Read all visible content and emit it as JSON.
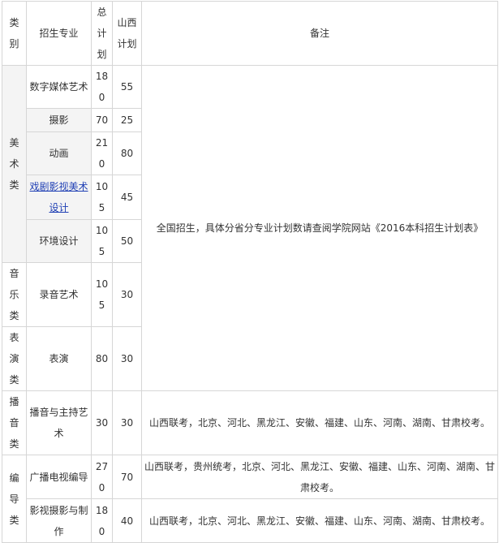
{
  "headers": {
    "category": "类别",
    "major": "招生专业",
    "total": "总计划",
    "shanxi": "山西计划",
    "note": "备注"
  },
  "categories": {
    "arts": "美术类",
    "music": "音乐类",
    "performance": "表演类",
    "broadcasting": "播音类",
    "directing": "编导类"
  },
  "rows": [
    {
      "major": "数字媒体艺术",
      "total": "180",
      "shanxi": "55"
    },
    {
      "major": "摄影",
      "total": "70",
      "shanxi": "25"
    },
    {
      "major": "动画",
      "total": "210",
      "shanxi": "80"
    },
    {
      "major": "戏剧影视美术设计",
      "total": "105",
      "shanxi": "45"
    },
    {
      "major": "环境设计",
      "total": "105",
      "shanxi": "50"
    },
    {
      "major": "录音艺术",
      "total": "105",
      "shanxi": "30"
    },
    {
      "major": "表演",
      "total": "80",
      "shanxi": "30"
    },
    {
      "major": "播音与主持艺术",
      "total": "30",
      "shanxi": "30"
    },
    {
      "major": "广播电视编导",
      "total": "270",
      "shanxi": "70"
    },
    {
      "major": "影视摄影与制作",
      "total": "180",
      "shanxi": "40"
    }
  ],
  "notes": {
    "national": "全国招生，具体分省分专业计划数请查阅学院网站《2016本科招生计划表》",
    "broadcasting": "山西联考，北京、河北、黑龙江、安徽、福建、山东、河南、湖南、甘肃校考。",
    "directing_tv": "山西联考，贵州统考，北京、河北、黑龙江、安徽、福建、山东、河南、湖南、甘肃校考。",
    "directing_film": "山西联考，北京、河北、黑龙江、安徽、福建、山东、河南、湖南、甘肃校考。"
  },
  "colors": {
    "link": "#1f3fb4",
    "border": "#d6d6d6",
    "shade": "#f4f4f4"
  }
}
